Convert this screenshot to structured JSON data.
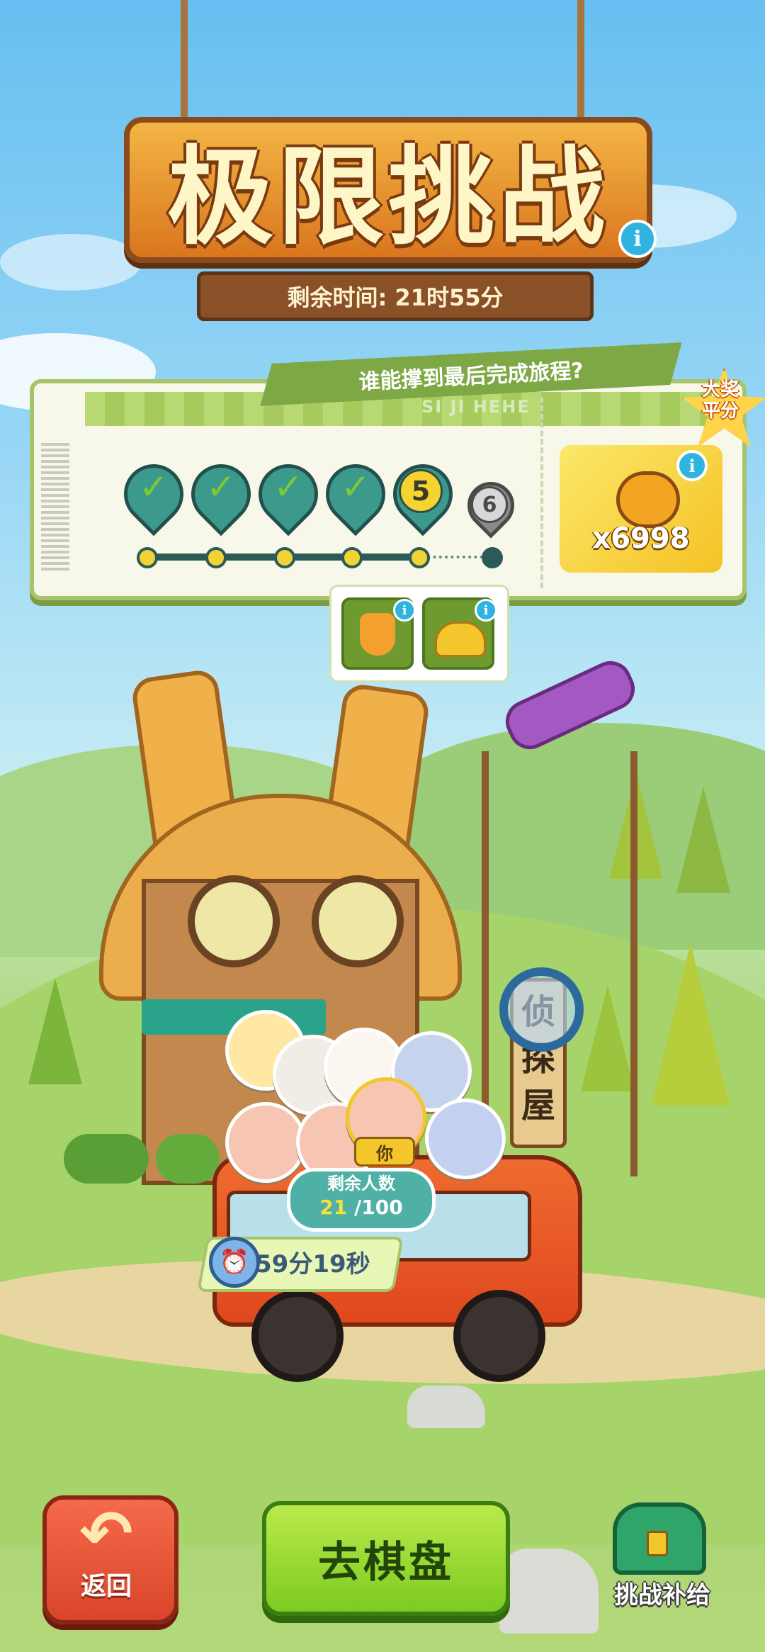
{
  "title": "极限挑战",
  "remaining_time": "剩余时间: 21时55分",
  "banner": "谁能撑到最后完成旅程?",
  "ticket_code": "SI JI HEHE",
  "stages": [
    {
      "label": "✓",
      "state": "done"
    },
    {
      "label": "✓",
      "state": "done"
    },
    {
      "label": "✓",
      "state": "done"
    },
    {
      "label": "✓",
      "state": "done"
    },
    {
      "label": "5",
      "state": "current"
    },
    {
      "label": "6",
      "state": "locked"
    }
  ],
  "grand_prize": {
    "badge_line1": "大奖",
    "badge_line2": "平分",
    "count": "x6998"
  },
  "stage_rewards": [
    {
      "icon": "tropical-drink-icon"
    },
    {
      "icon": "coin-pile-icon"
    }
  ],
  "players": {
    "you_label": "你",
    "remaining_title": "剩余人数",
    "remaining_current": "21",
    "remaining_total": "/100"
  },
  "countdown": "59分19秒",
  "shop_sign": "侦探屋",
  "buttons": {
    "back": "返回",
    "go_board": "去棋盘",
    "supply": "挑战补给"
  },
  "colors": {
    "accent_green": "#7dcb22",
    "back_red": "#d9452a",
    "pin_teal": "#3b9a8b"
  }
}
